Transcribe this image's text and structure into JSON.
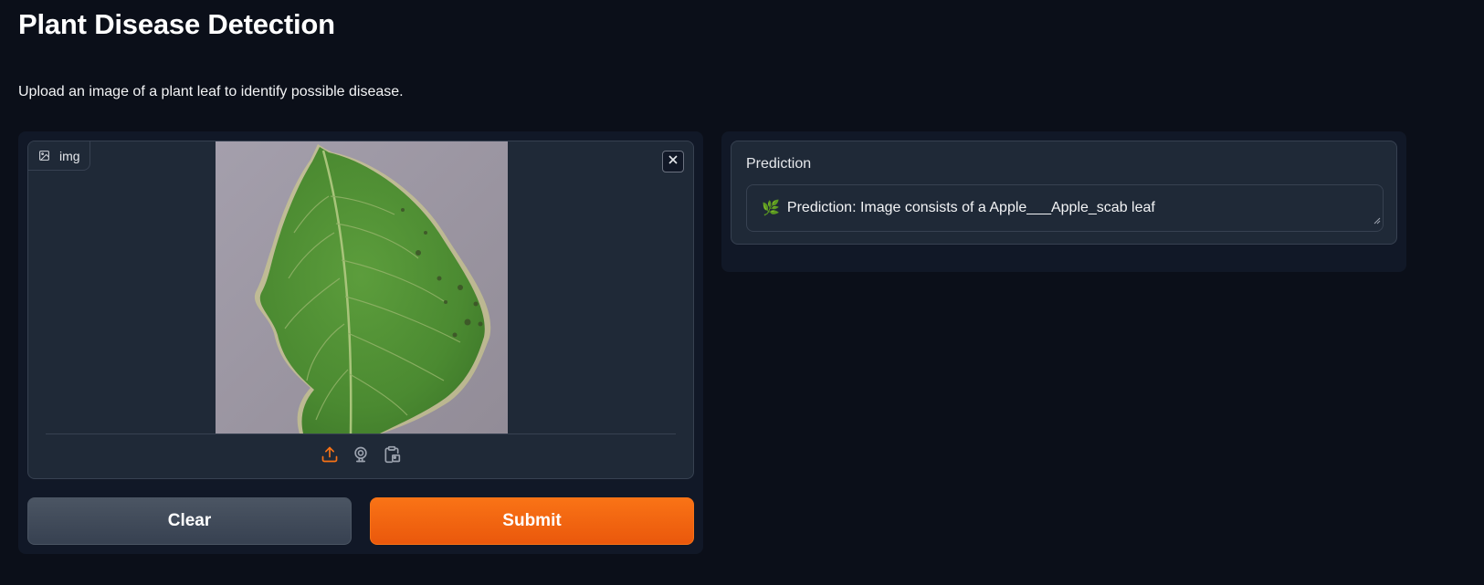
{
  "page": {
    "title": "Plant Disease Detection",
    "description": "Upload an image of a plant leaf to identify possible disease."
  },
  "input": {
    "label": "img",
    "image_description_icon": "image-icon",
    "sources": [
      "upload-icon",
      "webcam-icon",
      "clipboard-icon"
    ],
    "active_source": "upload-icon"
  },
  "actions": {
    "clear_label": "Clear",
    "submit_label": "Submit"
  },
  "output": {
    "label": "Prediction",
    "emoji": "🌿",
    "text": "Prediction: Image consists of a Apple___Apple_scab leaf"
  },
  "colors": {
    "background": "#0b0f19",
    "panel": "#111827",
    "block": "#1f2937",
    "border": "#374151",
    "accent": "#f97316",
    "secondary_button": "#4b5563"
  }
}
